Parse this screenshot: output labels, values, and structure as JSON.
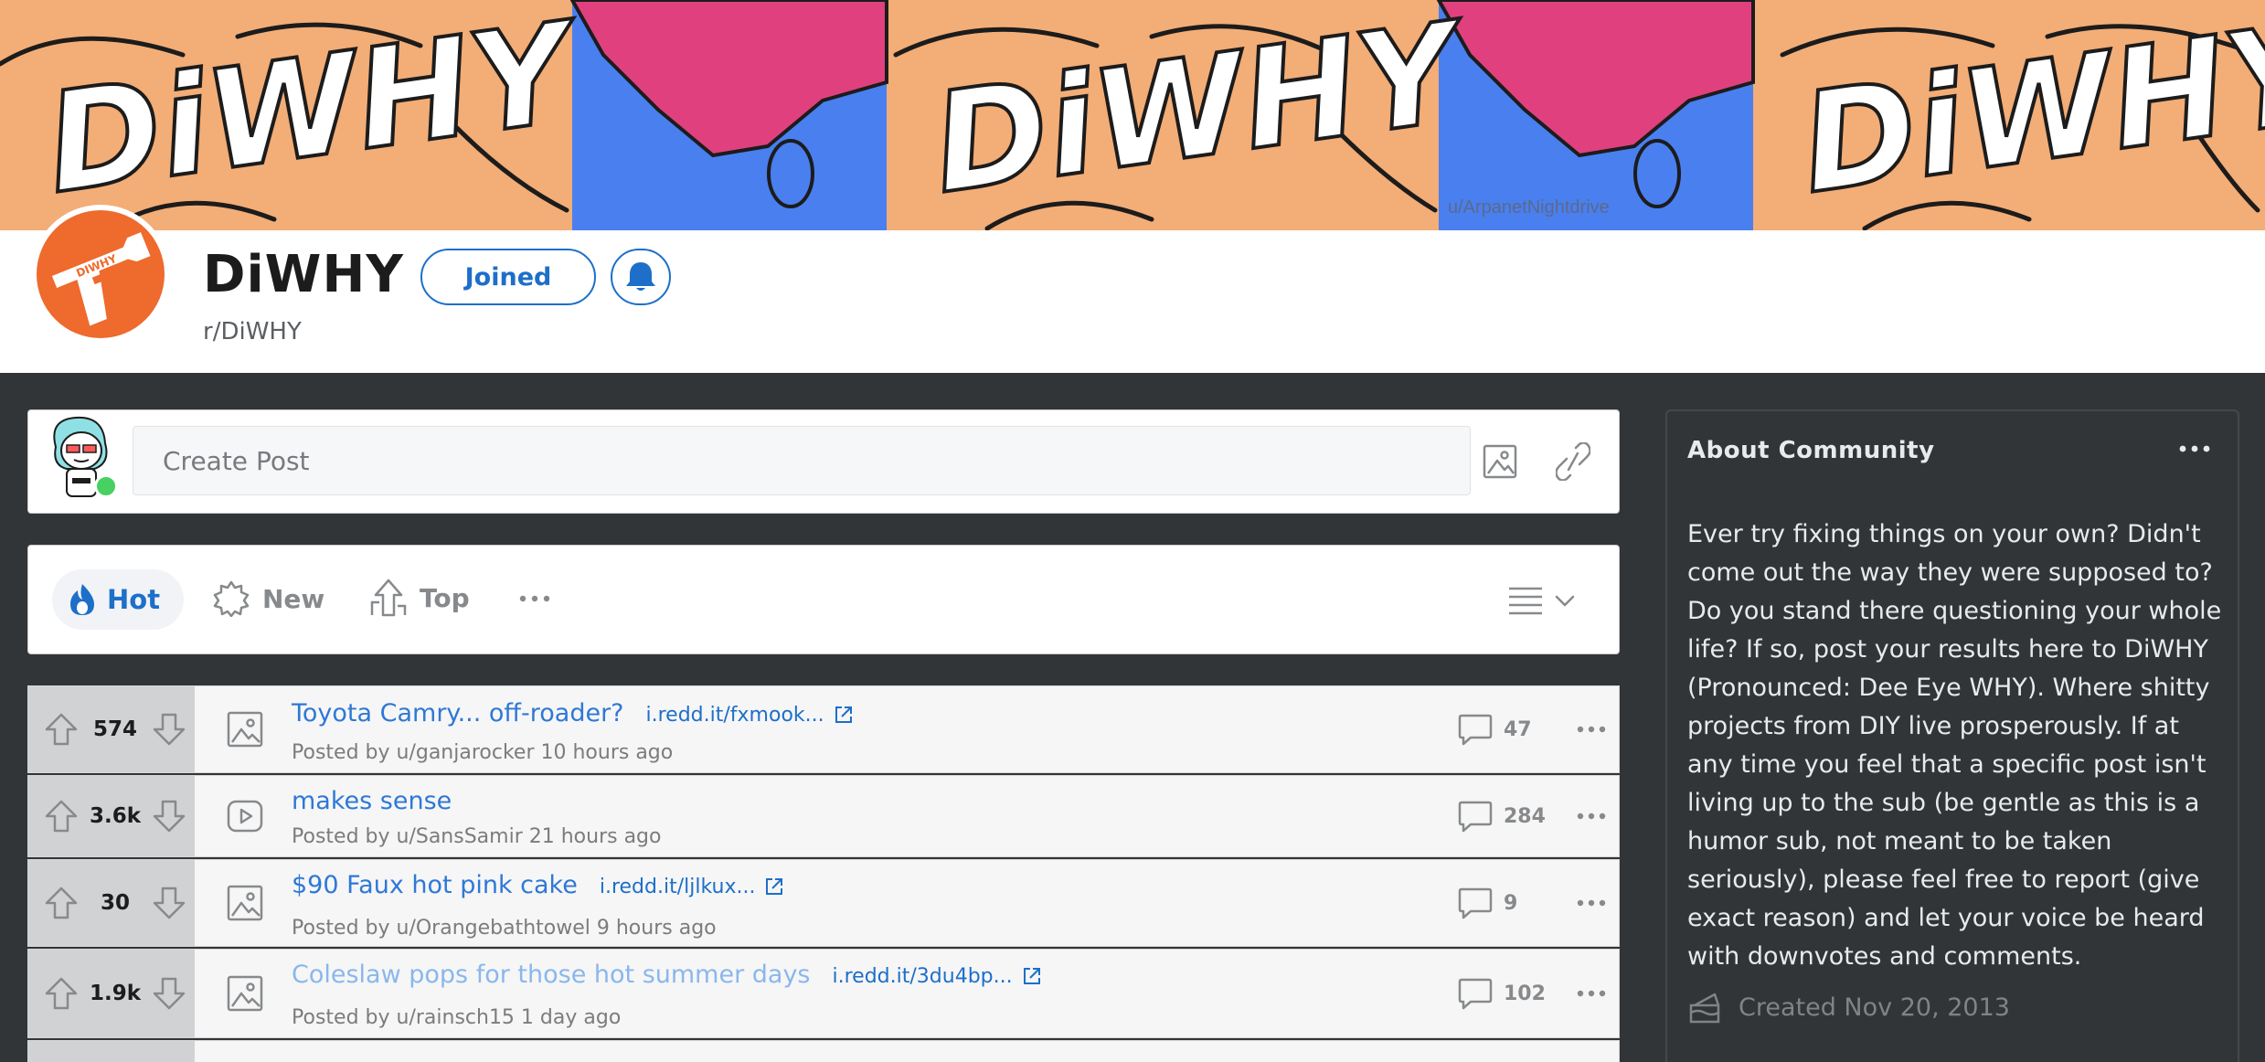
{
  "banner": {
    "credit": "u/ArpanetNightdrive",
    "repeated_text": "DiWHY"
  },
  "community": {
    "name": "DiWHY",
    "subreddit": "r/DiWHY",
    "joined_label": "Joined",
    "icon_text": "DIWHY"
  },
  "create_post": {
    "placeholder": "Create Post"
  },
  "sort": {
    "hot": "Hot",
    "new": "New",
    "top": "Top"
  },
  "posts": [
    {
      "votes": "574",
      "title": "Toyota Camry... off-roader?",
      "domain": "i.redd.it/fxmook...",
      "meta": "Posted by u/ganjarocker 10 hours ago",
      "comments": "47",
      "thumb": "image-icon"
    },
    {
      "votes": "3.6k",
      "title": "makes sense",
      "domain": "",
      "meta": "Posted by u/SansSamir 21 hours ago",
      "comments": "284",
      "thumb": "video-icon"
    },
    {
      "votes": "30",
      "title": "$90 Faux hot pink cake",
      "domain": "i.redd.it/ljlkux...",
      "meta": "Posted by u/Orangebathtowel 9 hours ago",
      "comments": "9",
      "thumb": "image-icon"
    },
    {
      "votes": "1.9k",
      "title": "Coleslaw pops for those hot summer days",
      "domain": "i.redd.it/3du4bp...",
      "meta": "Posted by u/rainsch15 1 day ago",
      "comments": "102",
      "thumb": "image-icon"
    }
  ],
  "about": {
    "title": "About Community",
    "description": "Ever try fixing things on your own? Didn't come out the way they were supposed to? Do you stand there questioning your whole life? If so, post your results here to DiWHY (Pronounced: Dee Eye WHY). Where shitty projects from DIY live prosperously. If at any time you feel that a specific post isn't living up to the sub (be gentle as this is a humor sub, not meant to be taken seriously), please feel free to report (give exact reason) and let your voice be heard with downvotes and comments.",
    "created": "Created Nov 20, 2013"
  },
  "colors": {
    "accent": "#1d6fc9",
    "brand_orange": "#ee6a2d",
    "dark_bg": "#323538",
    "online": "#46d160"
  }
}
